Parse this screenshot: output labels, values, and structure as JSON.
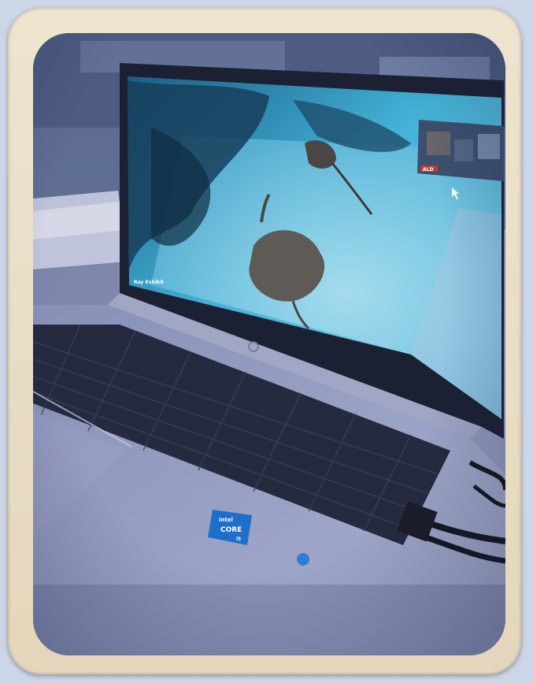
{
  "photo": {
    "subject": "laptop-on-desk",
    "screen_content": "underwater-stingray-video",
    "palette": {
      "frame": "#e8dcc4",
      "screen_water": "#3fb0d4",
      "keyboard": "#2a2f45",
      "deck": "#8d94b8",
      "sticker": "#1e6fc9",
      "desk": "#7b86a6"
    },
    "visible_labels": {
      "cpu_sticker_brand": "intel",
      "cpu_sticker_model": "CORE",
      "cpu_sticker_tier": "i5",
      "video_call_tag": "ALD",
      "caption_corner": "Ray Exhibit"
    }
  }
}
